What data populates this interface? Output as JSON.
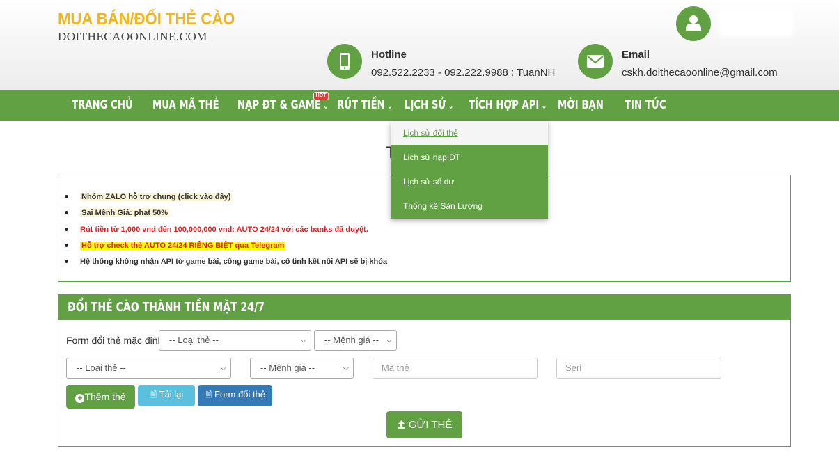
{
  "logo": {
    "title": "MUA BÁN/ĐỔI THẺ CÀO",
    "subtitle": "DOITHECAOONLINE.COM"
  },
  "header": {
    "user_icon": "user-icon",
    "hotline_label": "Hotline",
    "hotline_value": "092.522.2233 - 092.222.9988 : TuanNH",
    "hotline_icon": "mobile-phone-icon",
    "email_label": "Email",
    "email_value": "cskh.doithecaoonline@gmail.com",
    "email_icon": "envelope-icon"
  },
  "colors": {
    "brand_green": "#62a044",
    "logo_yellow": "#f0b61e",
    "alert_red": "#e21b1b",
    "info_blue": "#5bc0de",
    "primary_blue": "#337ab7"
  },
  "nav": {
    "items": [
      {
        "label": "TRANG CHỦ"
      },
      {
        "label": "MUA MÃ THẺ"
      },
      {
        "label": "NẠP ĐT & GAME"
      },
      {
        "label": "RÚT TIỀN"
      },
      {
        "label": "LỊCH SỬ"
      },
      {
        "label": "TÍCH HỢP API"
      },
      {
        "label": "MỜI BẠN"
      },
      {
        "label": "TIN TỨC"
      }
    ],
    "hot_badge": "HOT"
  },
  "history_menu": {
    "items": [
      {
        "label": "Lịch sử đổi thẻ"
      },
      {
        "label": "Lịch sử nạp ĐT"
      },
      {
        "label": "Lịch sử số dư"
      },
      {
        "label": "Thống kê Sản Lượng"
      }
    ]
  },
  "page_title_fragment": "T",
  "notices": [
    {
      "text": "Nhóm ZALO hỗ trợ chung (click vào đây)"
    },
    {
      "text": "Sai Mệnh Giá: phạt 50%"
    },
    {
      "text": "Rút tiền từ 1,000 vnd đến 100,000,000 vnd: AUTO 24/24 với các banks đã duyệt."
    },
    {
      "text": "Hỗ trợ check thẻ AUTO 24/24 RIÊNG BIỆT qua Telegram"
    },
    {
      "text": "Hệ thống không nhận API từ game bài, cổng game bài, cố tình kết nối API sẽ bị khóa"
    }
  ],
  "form": {
    "title": "ĐỔI THẺ CÀO THÀNH TIỀN MẶT 24/7",
    "default_label": "Form đổi thẻ mặc định:",
    "card_type_placeholder": "-- Loại thẻ --",
    "denomination_placeholder": "-- Mệnh giá --",
    "card_code_placeholder": "Mã thẻ",
    "serial_placeholder": "Seri",
    "add_card_label": "Thêm thẻ",
    "reload_label": "Tải lại",
    "change_form_label": "Form đổi thẻ",
    "submit_label": "GỬI THẺ"
  }
}
